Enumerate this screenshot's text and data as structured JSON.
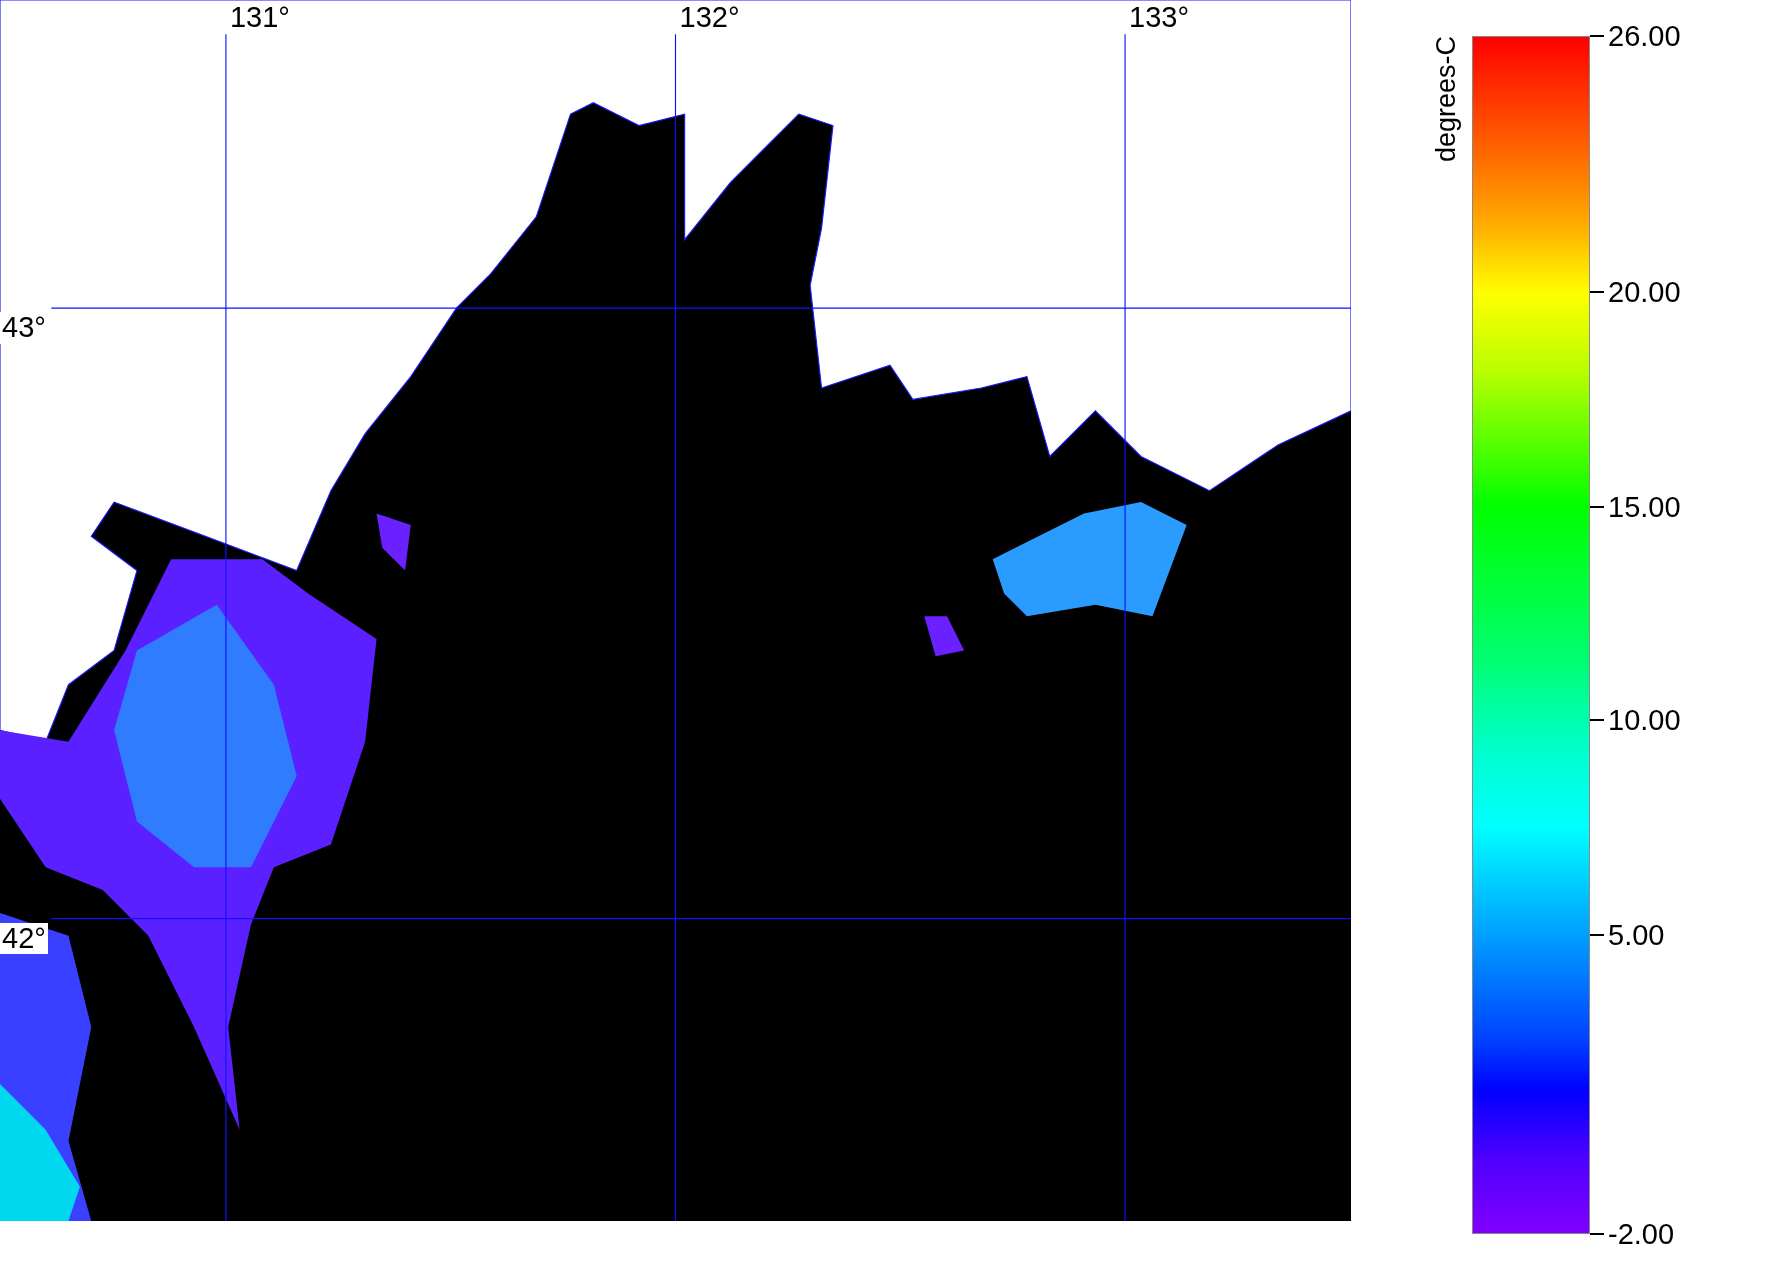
{
  "map": {
    "lon_labels": [
      "131°",
      "132°",
      "133°"
    ],
    "lat_labels": [
      "43°",
      "42°"
    ]
  },
  "colorbar": {
    "unit": "degrees-C",
    "ticks": [
      "26.00",
      "20.00",
      "15.00",
      "10.00",
      "5.00",
      "-2.00"
    ]
  }
}
